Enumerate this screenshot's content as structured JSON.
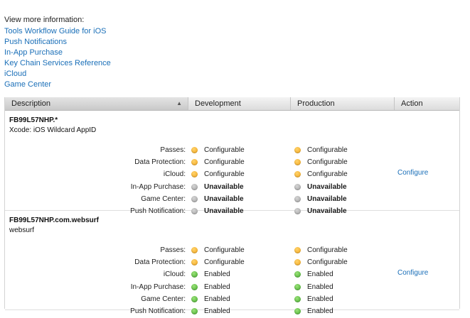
{
  "intro": "View more information:",
  "links": [
    "Tools Workflow Guide for iOS",
    "Push Notifications",
    "In-App Purchase",
    "Key Chain Services Reference",
    "iCloud",
    "Game Center"
  ],
  "table": {
    "headers": {
      "description": "Description",
      "development": "Development",
      "production": "Production",
      "action": "Action"
    },
    "sort_icon": "sort-ascending-icon",
    "groups": [
      {
        "id": "FB99L57NHP.*",
        "name": "Xcode: iOS Wildcard AppID",
        "action_label": "Configure",
        "capabilities": [
          {
            "label": "Passes:",
            "dev": "Configurable",
            "dev_status": "orange",
            "prod": "Configurable",
            "prod_status": "orange"
          },
          {
            "label": "Data Protection:",
            "dev": "Configurable",
            "dev_status": "orange",
            "prod": "Configurable",
            "prod_status": "orange"
          },
          {
            "label": "iCloud:",
            "dev": "Configurable",
            "dev_status": "orange",
            "prod": "Configurable",
            "prod_status": "orange"
          },
          {
            "label": "In-App Purchase:",
            "dev": "Unavailable",
            "dev_status": "gray",
            "prod": "Unavailable",
            "prod_status": "gray"
          },
          {
            "label": "Game Center:",
            "dev": "Unavailable",
            "dev_status": "gray",
            "prod": "Unavailable",
            "prod_status": "gray"
          },
          {
            "label": "Push Notification:",
            "dev": "Unavailable",
            "dev_status": "gray",
            "prod": "Unavailable",
            "prod_status": "gray"
          }
        ]
      },
      {
        "id": "FB99L57NHP.com.websurf",
        "name": "websurf",
        "action_label": "Configure",
        "capabilities": [
          {
            "label": "Passes:",
            "dev": "Configurable",
            "dev_status": "orange",
            "prod": "Configurable",
            "prod_status": "orange"
          },
          {
            "label": "Data Protection:",
            "dev": "Configurable",
            "dev_status": "orange",
            "prod": "Configurable",
            "prod_status": "orange"
          },
          {
            "label": "iCloud:",
            "dev": "Enabled",
            "dev_status": "green",
            "prod": "Enabled",
            "prod_status": "green"
          },
          {
            "label": "In-App Purchase:",
            "dev": "Enabled",
            "dev_status": "green",
            "prod": "Enabled",
            "prod_status": "green"
          },
          {
            "label": "Game Center:",
            "dev": "Enabled",
            "dev_status": "green",
            "prod": "Enabled",
            "prod_status": "green"
          },
          {
            "label": "Push Notification:",
            "dev": "Enabled",
            "dev_status": "green",
            "prod": "Enabled",
            "prod_status": "green"
          }
        ]
      }
    ]
  },
  "colors": {
    "link": "#1a6fb8",
    "configurable": "#f0a21a",
    "unavailable": "#9e9e9e",
    "enabled": "#3fa829"
  }
}
